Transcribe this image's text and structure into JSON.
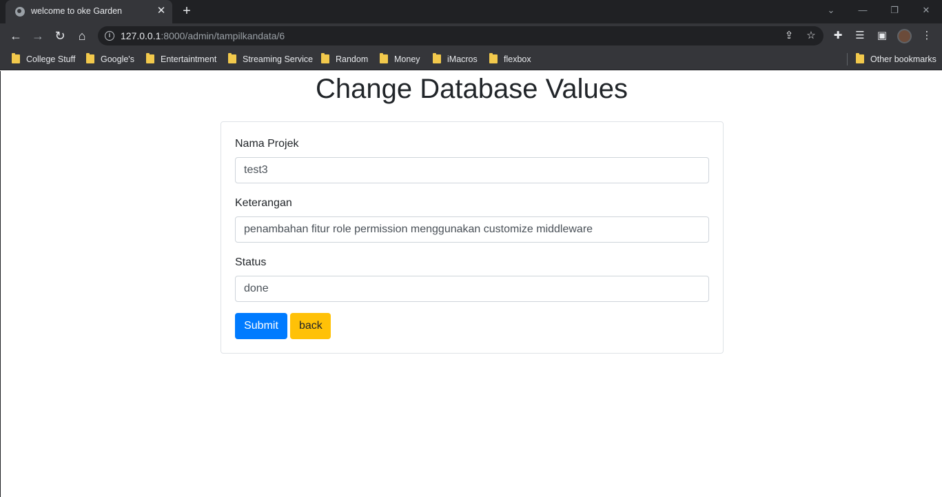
{
  "browser": {
    "tab_title": "welcome to oke Garden",
    "url_host": "127.0.0.1",
    "url_rest": ":8000/admin/tampilkandata/6",
    "bookmarks": [
      "College Stuff",
      "Google's",
      "Entertaintment",
      "Streaming Service",
      "Random",
      "Money",
      "iMacros",
      "flexbox"
    ],
    "other_bookmarks": "Other bookmarks"
  },
  "page": {
    "title": "Change Database Values",
    "form": {
      "fields": [
        {
          "label": "Nama Projek",
          "value": "test3"
        },
        {
          "label": "Keterangan",
          "value": "penambahan fitur role permission menggunakan customize middleware"
        },
        {
          "label": "Status",
          "value": "done"
        }
      ],
      "submit_label": "Submit",
      "back_label": "back"
    }
  },
  "colors": {
    "submit": "#007bff",
    "back": "#ffc107"
  }
}
